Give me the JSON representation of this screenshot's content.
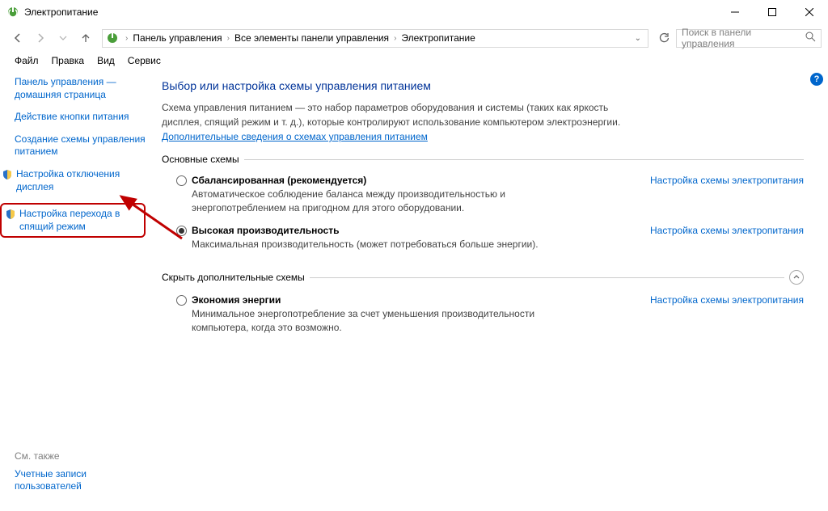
{
  "window": {
    "title": "Электропитание"
  },
  "breadcrumbs": {
    "root": "Панель управления",
    "mid": "Все элементы панели управления",
    "leaf": "Электропитание"
  },
  "search": {
    "placeholder": "Поиск в панели управления"
  },
  "menu": {
    "file": "Файл",
    "edit": "Правка",
    "view": "Вид",
    "tools": "Сервис"
  },
  "sidebar": {
    "home": "Панель управления — домашняя страница",
    "button_action": "Действие кнопки питания",
    "create_plan": "Создание схемы управления питанием",
    "display_off": "Настройка отключения дисплея",
    "sleep": "Настройка перехода в спящий режим",
    "see_also": "См. также",
    "user_accounts": "Учетные записи пользователей"
  },
  "content": {
    "heading": "Выбор или настройка схемы управления питанием",
    "desc": "Схема управления питанием — это набор параметров оборудования и системы (таких как яркость дисплея, спящий режим и т. д.), которые контролируют использование компьютером электроэнергии.",
    "more_link": "Дополнительные сведения о схемах управления питанием",
    "section_main": "Основные схемы",
    "section_hidden": "Скрыть дополнительные схемы",
    "change_link": "Настройка схемы электропитания",
    "plans": {
      "balanced": {
        "name": "Сбалансированная (рекомендуется)",
        "desc": "Автоматическое соблюдение баланса между производительностью и энергопотреблением на пригодном для этого оборудовании."
      },
      "high": {
        "name": "Высокая производительность",
        "desc": "Максимальная производительность (может потребоваться больше энергии)."
      },
      "eco": {
        "name": "Экономия энергии",
        "desc": "Минимальное энергопотребление за счет уменьшения производительности компьютера, когда это возможно."
      }
    }
  }
}
